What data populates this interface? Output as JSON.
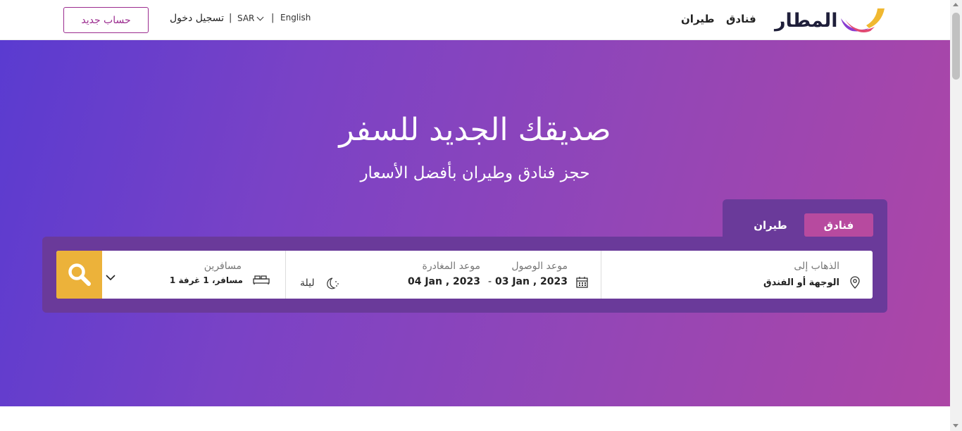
{
  "header": {
    "logo_text": "المطار",
    "nav": {
      "hotels": "فنادق",
      "flights": "طيران"
    },
    "language": "English",
    "currency": "SAR",
    "separator": "|",
    "login": "تسجيل دخول",
    "signup": "حساب جديد"
  },
  "hero": {
    "title": "صديقك الجديد للسفر",
    "subtitle": "حجز فنادق وطيران بأفضل الأسعار"
  },
  "tabs": {
    "hotels": "فنادق",
    "flights": "طيران",
    "active": "hotels"
  },
  "search": {
    "destination_label": "الذهاب إلى",
    "destination_value": "الوجهة أو الفندق",
    "arrival_label": "موعد الوصول",
    "arrival_value": "03 Jan , 2023",
    "date_separator": "-",
    "departure_label": "موعد المغادرة",
    "departure_value": "04 Jan , 2023",
    "nights_label": "ليلة",
    "guests_label": "مسافرين",
    "guests_value": "1 مسافر، 1 غرفة"
  },
  "colors": {
    "brand_purple": "#9b2c8f",
    "panel": "#6a3a9a",
    "active_tab": "#b74a9f",
    "search_button": "#ecb23a"
  }
}
